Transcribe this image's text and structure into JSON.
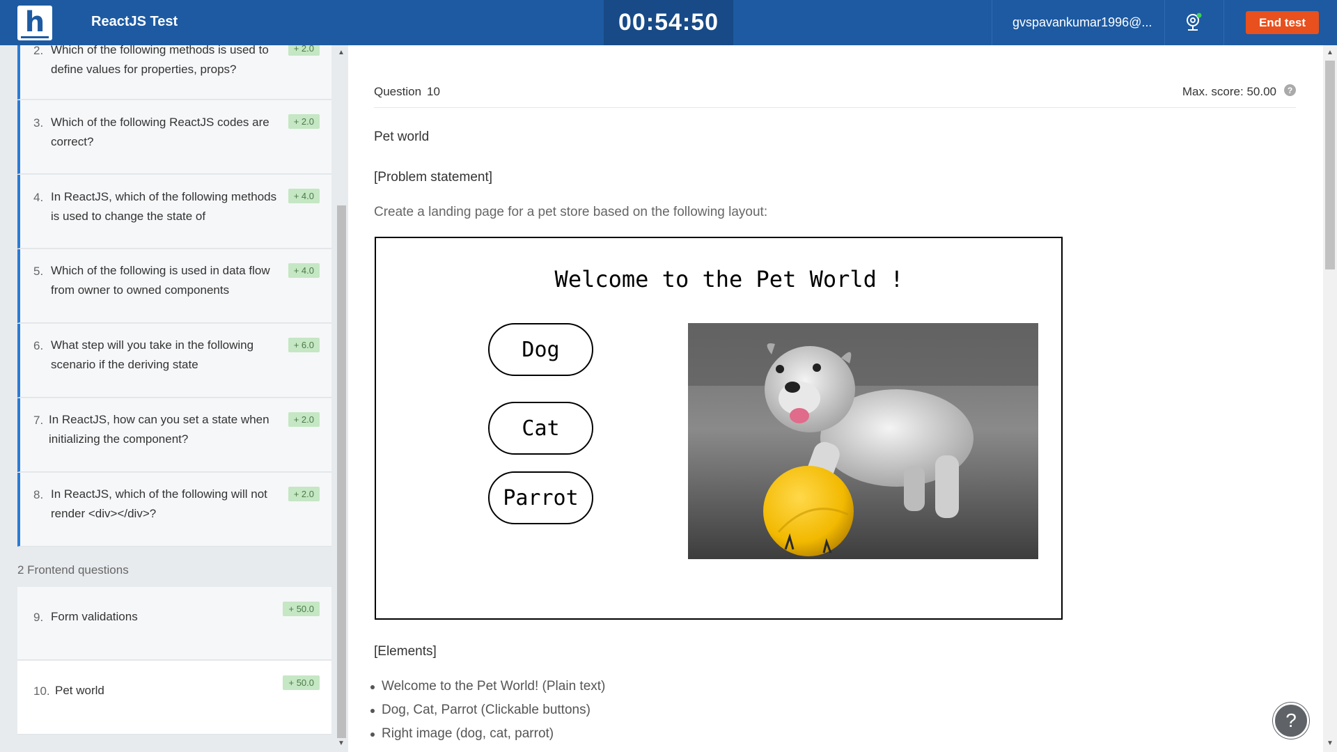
{
  "header": {
    "logo_letter": "h",
    "title": "ReactJS Test",
    "timer": "00:54:50",
    "user_email": "gvspavankumar1996@...",
    "end_button": "End test"
  },
  "sidebar": {
    "questions": [
      {
        "num": "2.",
        "text": "Which of the following methods is used to define values for properties, props?",
        "score": "+ 2.0"
      },
      {
        "num": "3.",
        "text": "Which of the following ReactJS codes are correct?",
        "score": "+ 2.0"
      },
      {
        "num": "4.",
        "text": "In ReactJS, which of the following methods is used to change the state of",
        "score": "+ 4.0"
      },
      {
        "num": "5.",
        "text": "Which of the following is used in data flow from owner to owned components",
        "score": "+ 4.0"
      },
      {
        "num": "6.",
        "text": "What step will you take in the following scenario if the deriving state",
        "score": "+ 6.0"
      },
      {
        "num": "7.",
        "text": "In ReactJS, how can you set a state when initializing the component?",
        "score": "+ 2.0"
      },
      {
        "num": "8.",
        "text": "In ReactJS, which of the following will not render <div></div>?",
        "score": "+ 2.0"
      }
    ],
    "section_label": "2 Frontend questions",
    "frontend": [
      {
        "num": "9.",
        "text": "Form validations",
        "score": "+ 50.0"
      },
      {
        "num": "10.",
        "text": "Pet world",
        "score": "+ 50.0"
      }
    ]
  },
  "main": {
    "question_label": "Question",
    "question_number": "10",
    "max_score": "Max. score: 50.00",
    "title": "Pet world",
    "problem_heading": "[Problem statement]",
    "description": "Create a landing page for a pet store based on the following layout:",
    "mock": {
      "heading": "Welcome to the Pet World !",
      "buttons": [
        "Dog",
        "Cat",
        "Parrot"
      ]
    },
    "elements_heading": "[Elements]",
    "elements": [
      "Welcome to the Pet World! (Plain text)",
      "Dog, Cat, Parrot (Clickable buttons)",
      "Right image (dog, cat, parrot)"
    ]
  },
  "colors": {
    "header_bg": "#1d5aa2",
    "timer_bg": "#174a86",
    "end_button": "#e8501d",
    "badge_bg": "#c5e7c4",
    "active_border": "#2a7ad6"
  }
}
